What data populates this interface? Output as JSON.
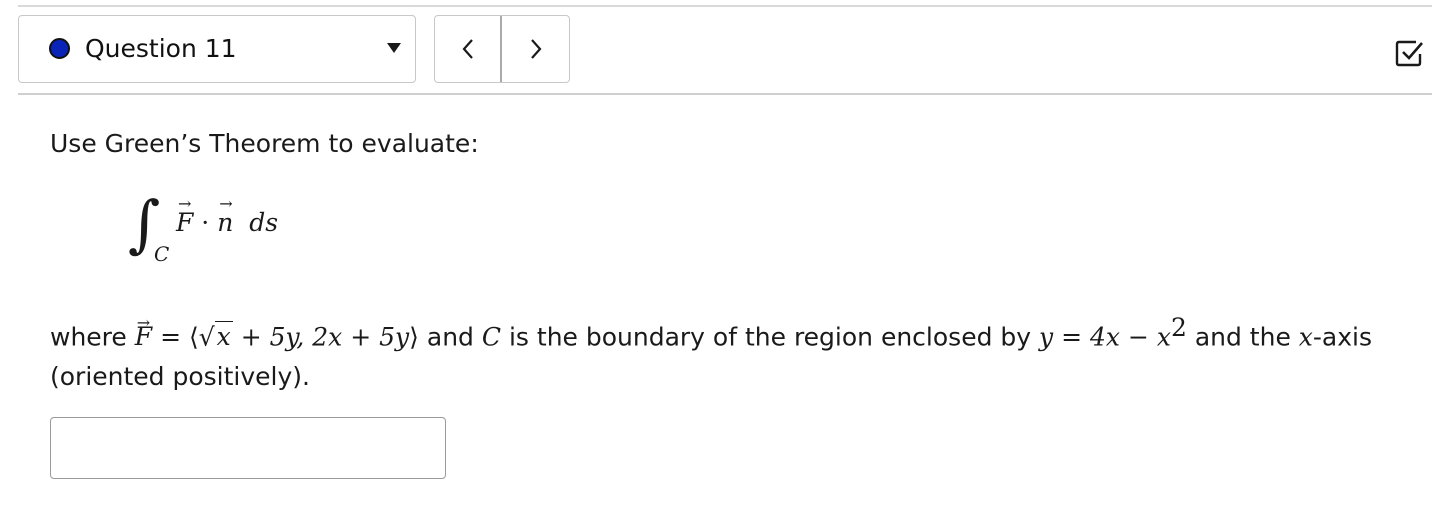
{
  "header": {
    "question_label": "Question 11",
    "status_color": "#0a24b8",
    "nav_prev_icon": "chevron-left-icon",
    "nav_next_icon": "chevron-right-icon",
    "submit_icon": "check-square-icon"
  },
  "question": {
    "prompt": "Use Green’s Theorem to evaluate:",
    "integral": {
      "sign": "∫",
      "subscript": "C",
      "integrand": "F · n ds"
    },
    "description": {
      "w_where": "where",
      "F": "F",
      "eq": "=",
      "langle": "⟨",
      "x_under_root": "x",
      "plus_5y": "+ 5y,",
      "two_x": "2x",
      "plus_5y_2": "+ 5y",
      "rangle": "⟩",
      "w_and_1": "and",
      "C": "C",
      "w_boundary": "is the boundary of the region enclosed by",
      "y": "y",
      "eq2": "=",
      "rhs_4x": "4x −",
      "x2": "x",
      "exp": "2",
      "w_and_the": "and the",
      "x_axis_var": "x",
      "w_axis": "-axis (oriented positively)."
    },
    "answer": {
      "value": "",
      "placeholder": ""
    }
  }
}
